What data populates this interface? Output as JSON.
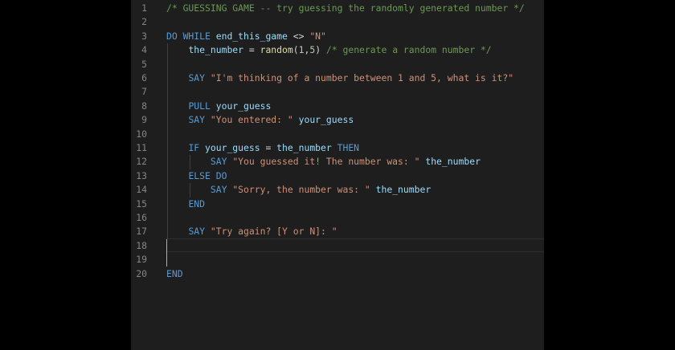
{
  "editor": {
    "lines": [
      {
        "n": "1",
        "indent": 0,
        "tokens": [
          {
            "t": "comment",
            "v": "/* GUESSING GAME -- try guessing the randomly generated number */"
          }
        ]
      },
      {
        "n": "2",
        "indent": 0,
        "tokens": []
      },
      {
        "n": "3",
        "indent": 0,
        "tokens": [
          {
            "t": "kw",
            "v": "DO WHILE "
          },
          {
            "t": "var",
            "v": "end_this_game"
          },
          {
            "t": "op",
            "v": " <> "
          },
          {
            "t": "str",
            "v": "\"N\""
          }
        ]
      },
      {
        "n": "4",
        "indent": 1,
        "tokens": [
          {
            "t": "var",
            "v": "the_number"
          },
          {
            "t": "op",
            "v": " = "
          },
          {
            "t": "fn",
            "v": "random"
          },
          {
            "t": "plain",
            "v": "("
          },
          {
            "t": "num",
            "v": "1"
          },
          {
            "t": "plain",
            "v": ","
          },
          {
            "t": "num",
            "v": "5"
          },
          {
            "t": "plain",
            "v": ") "
          },
          {
            "t": "comment",
            "v": "/* generate a random number */"
          }
        ]
      },
      {
        "n": "5",
        "indent": 1,
        "tokens": []
      },
      {
        "n": "6",
        "indent": 1,
        "tokens": [
          {
            "t": "kw",
            "v": "SAY "
          },
          {
            "t": "str",
            "v": "\"I'm thinking of a number between 1 and 5, what is it?\""
          }
        ]
      },
      {
        "n": "7",
        "indent": 1,
        "tokens": []
      },
      {
        "n": "8",
        "indent": 1,
        "tokens": [
          {
            "t": "kw",
            "v": "PULL "
          },
          {
            "t": "var",
            "v": "your_guess"
          }
        ]
      },
      {
        "n": "9",
        "indent": 1,
        "tokens": [
          {
            "t": "kw",
            "v": "SAY "
          },
          {
            "t": "str",
            "v": "\"You entered: \""
          },
          {
            "t": "plain",
            "v": " "
          },
          {
            "t": "var",
            "v": "your_guess"
          }
        ]
      },
      {
        "n": "10",
        "indent": 1,
        "tokens": []
      },
      {
        "n": "11",
        "indent": 1,
        "tokens": [
          {
            "t": "kw",
            "v": "IF "
          },
          {
            "t": "var",
            "v": "your_guess"
          },
          {
            "t": "op",
            "v": " = "
          },
          {
            "t": "var",
            "v": "the_number"
          },
          {
            "t": "kw",
            "v": " THEN"
          }
        ]
      },
      {
        "n": "12",
        "indent": 2,
        "tokens": [
          {
            "t": "kw",
            "v": "SAY "
          },
          {
            "t": "str",
            "v": "\"You guessed it! The number was: \""
          },
          {
            "t": "plain",
            "v": " "
          },
          {
            "t": "var",
            "v": "the_number"
          }
        ]
      },
      {
        "n": "13",
        "indent": 1,
        "tokens": [
          {
            "t": "kw",
            "v": "ELSE DO"
          }
        ]
      },
      {
        "n": "14",
        "indent": 2,
        "tokens": [
          {
            "t": "kw",
            "v": "SAY "
          },
          {
            "t": "str",
            "v": "\"Sorry, the number was: \""
          },
          {
            "t": "plain",
            "v": " "
          },
          {
            "t": "var",
            "v": "the_number"
          }
        ]
      },
      {
        "n": "15",
        "indent": 1,
        "tokens": [
          {
            "t": "kw",
            "v": "END"
          }
        ]
      },
      {
        "n": "16",
        "indent": 1,
        "tokens": []
      },
      {
        "n": "17",
        "indent": 1,
        "tokens": [
          {
            "t": "kw",
            "v": "SAY "
          },
          {
            "t": "str",
            "v": "\"Try again? [Y or N]: \""
          }
        ]
      },
      {
        "n": "18",
        "indent": 0,
        "tokens": []
      },
      {
        "n": "19",
        "indent": 0,
        "tokens": []
      },
      {
        "n": "20",
        "indent": 0,
        "tokens": [
          {
            "t": "kw",
            "v": "END"
          }
        ]
      }
    ],
    "theme": {
      "background": "#1e1e1e",
      "line_number": "#858585",
      "comment": "#6a9955",
      "keyword": "#569cd6",
      "variable": "#9cdcfe",
      "string": "#ce9178",
      "function": "#dcdcaa",
      "number": "#b5cea8"
    }
  }
}
